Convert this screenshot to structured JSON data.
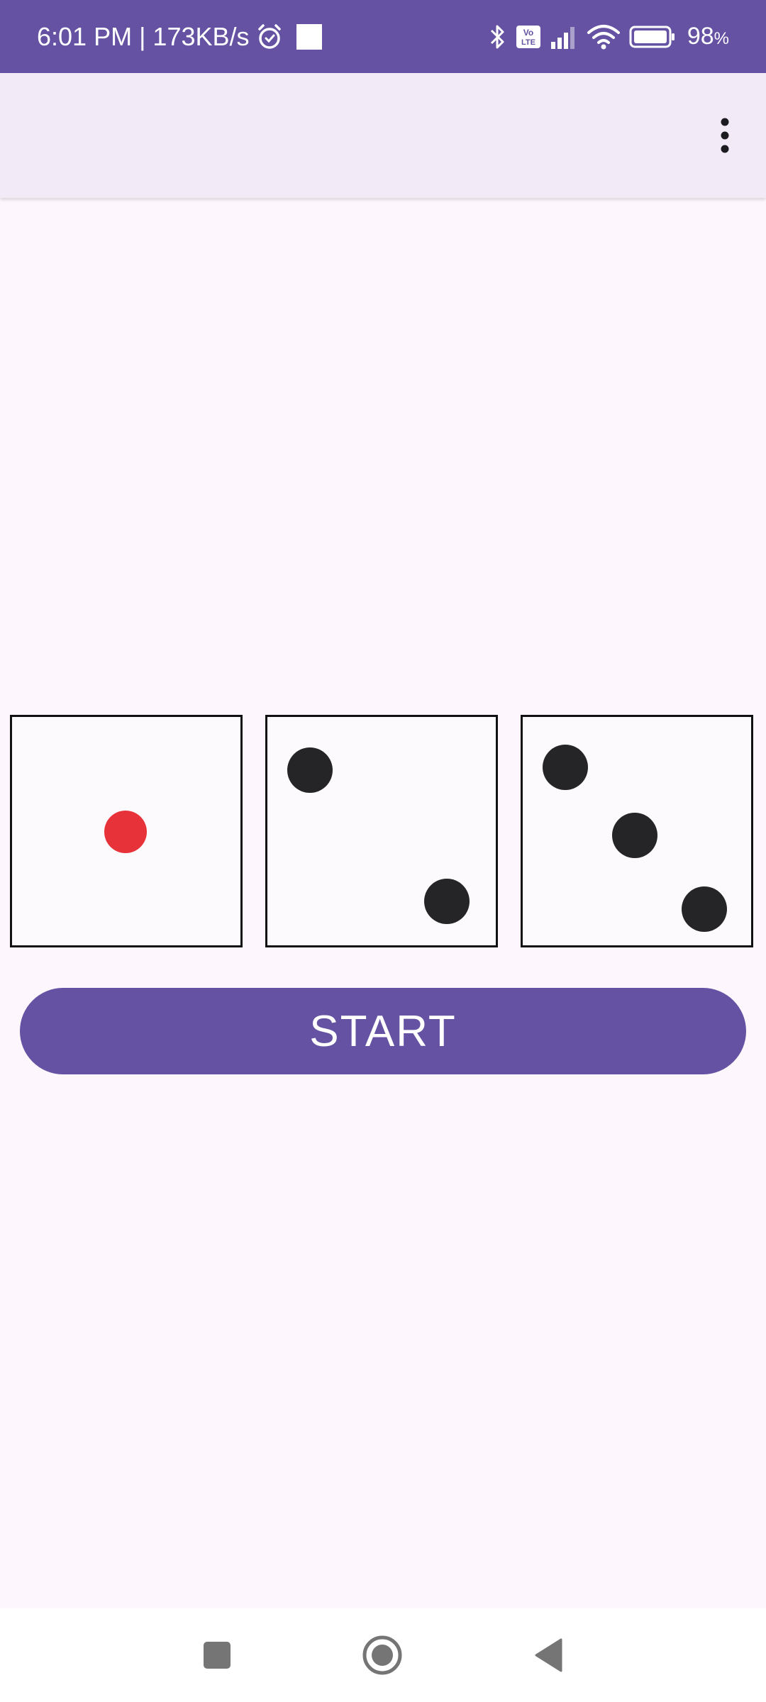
{
  "status_bar": {
    "time_speed": "6:01 PM | 173KB/s",
    "battery_percent": "98",
    "battery_unit": "%",
    "icons": [
      "alarm-icon",
      "notification-square-icon",
      "bluetooth-icon",
      "volte-icon",
      "signal-icon",
      "wifi-icon",
      "battery-icon"
    ],
    "volte_label_top": "Vo",
    "volte_label_bottom": "LTE"
  },
  "app_bar": {
    "menu_icon": "more-vert-icon"
  },
  "dice": [
    {
      "value": 1,
      "highlight_color": "#e8323a"
    },
    {
      "value": 2
    },
    {
      "value": 3
    }
  ],
  "start_button": {
    "label": "START"
  },
  "nav_bar": {
    "icons": [
      "recents-icon",
      "home-icon",
      "back-icon"
    ]
  },
  "colors": {
    "primary": "#6552a3",
    "app_bar_bg": "#f3eaf7",
    "page_bg": "#fdf7fd",
    "pip": "#252527",
    "pip_highlight": "#e8323a"
  }
}
